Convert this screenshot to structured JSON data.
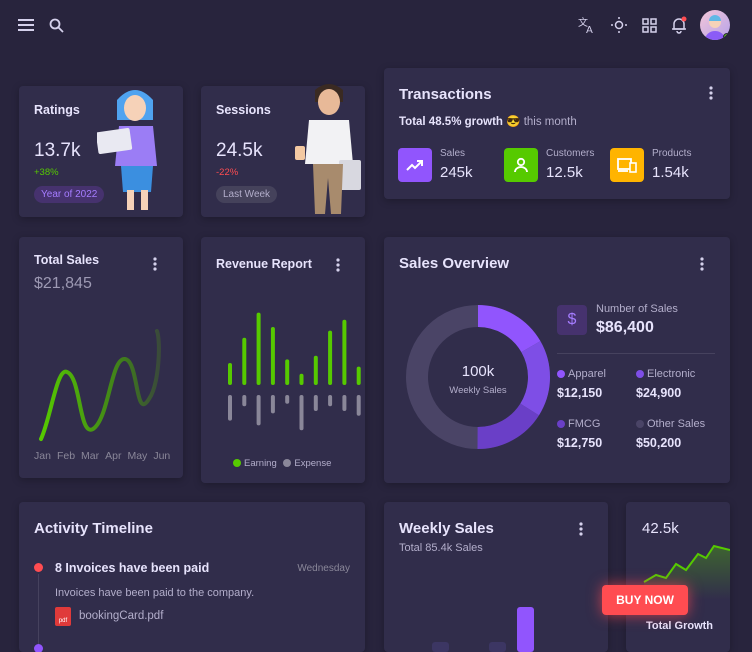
{
  "ratings": {
    "title": "Ratings",
    "value": "13.7k",
    "change": "+38%",
    "chip": "Year of 2022"
  },
  "sessions": {
    "title": "Sessions",
    "value": "24.5k",
    "change": "-22%",
    "chip": "Last Week"
  },
  "transactions": {
    "title": "Transactions",
    "growth_bold": "Total 48.5% growth",
    "growth_emoji": "😎",
    "growth_rest": "this month",
    "stats": [
      {
        "label": "Sales",
        "value": "245k",
        "color": "#9155fd",
        "icon": "trending-up-icon"
      },
      {
        "label": "Customers",
        "value": "12.5k",
        "color": "#56ca00",
        "icon": "account-icon"
      },
      {
        "label": "Products",
        "value": "1.54k",
        "color": "#ffb400",
        "icon": "devices-icon"
      }
    ]
  },
  "total_sales": {
    "title": "Total Sales",
    "value": "$21,845",
    "months": [
      "Jan",
      "Feb",
      "Mar",
      "Apr",
      "May",
      "Jun"
    ]
  },
  "revenue": {
    "title": "Revenue Report",
    "legend_earning": "Earning",
    "legend_expense": "Expense",
    "earning_color": "#56ca00",
    "expense_color": "#8a8799",
    "earning": [
      0.25,
      0.6,
      0.95,
      0.75,
      0.3,
      0.1,
      0.35,
      0.7,
      0.85,
      0.2
    ],
    "expense": [
      0.45,
      0.15,
      0.55,
      0.3,
      0.1,
      0.65,
      0.25,
      0.15,
      0.25,
      0.35
    ]
  },
  "sales_overview": {
    "title": "Sales Overview",
    "center_value": "100k",
    "center_label": "Weekly Sales",
    "number_label": "Number of Sales",
    "number_value": "$86,400",
    "items": [
      {
        "label": "Apparel",
        "value": "$12,150",
        "color": "#9155fd"
      },
      {
        "label": "Electronic",
        "value": "$24,900",
        "color": "#7e4ee6"
      },
      {
        "label": "FMCG",
        "value": "$12,750",
        "color": "#6a3fc7"
      },
      {
        "label": "Other Sales",
        "value": "$50,200",
        "color": "#4a4466"
      }
    ]
  },
  "timeline": {
    "title": "Activity Timeline",
    "item_title": "8 Invoices have been paid",
    "item_time": "Wednesday",
    "item_desc": "Invoices have been paid to the company.",
    "file": "bookingCard.pdf",
    "file_icon_label": "pdf"
  },
  "weekly": {
    "title": "Weekly Sales",
    "subtitle": "Total 85.4k Sales",
    "bars": [
      0.1,
      0.1,
      0.45
    ]
  },
  "growth": {
    "value": "42.5k",
    "label": "Total Growth"
  },
  "buy_now": "BUY NOW"
}
